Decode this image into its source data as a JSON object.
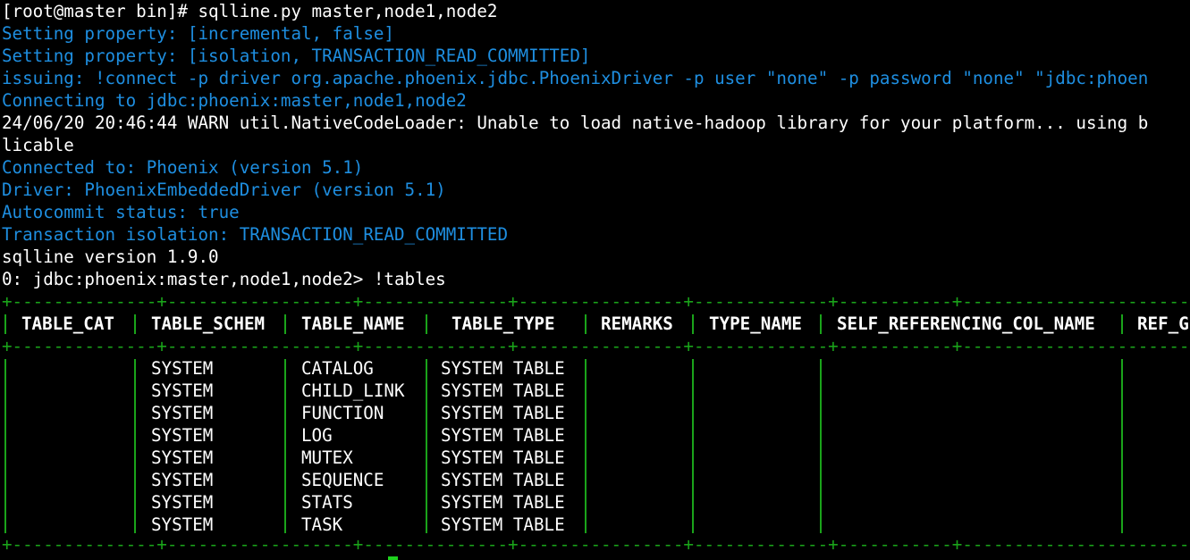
{
  "terminal": {
    "lines": [
      {
        "text": "[root@master bin]# sqlline.py master,node1,node2",
        "color": "white"
      },
      {
        "text": "Setting property: [incremental, false]",
        "color": "blue"
      },
      {
        "text": "Setting property: [isolation, TRANSACTION_READ_COMMITTED]",
        "color": "blue"
      },
      {
        "text": "issuing: !connect -p driver org.apache.phoenix.jdbc.PhoenixDriver -p user \"none\" -p password \"none\" \"jdbc:phoen",
        "color": "blue"
      },
      {
        "text": "Connecting to jdbc:phoenix:master,node1,node2",
        "color": "blue"
      },
      {
        "text": "24/06/20 20:46:44 WARN util.NativeCodeLoader: Unable to load native-hadoop library for your platform... using b",
        "color": "white"
      },
      {
        "text": "licable",
        "color": "white"
      },
      {
        "text": "Connected to: Phoenix (version 5.1)",
        "color": "blue"
      },
      {
        "text": "Driver: PhoenixEmbeddedDriver (version 5.1)",
        "color": "blue"
      },
      {
        "text": "Autocommit status: true",
        "color": "blue"
      },
      {
        "text": "Transaction isolation: TRANSACTION_READ_COMMITTED",
        "color": "blue"
      },
      {
        "text": "sqlline version 1.9.0",
        "color": "white"
      },
      {
        "text": "0: jdbc:phoenix:master,node1,node2> !tables",
        "color": "white"
      }
    ]
  },
  "table": {
    "border_text": "+--------------+------------------+--------------+----------------+-------------+-----------+--------------------------+----------",
    "columns": [
      "TABLE_CAT",
      "TABLE_SCHEM",
      "TABLE_NAME",
      "TABLE_TYPE",
      "REMARKS",
      "TYPE_NAME",
      "SELF_REFERENCING_COL_NAME",
      "REF_G"
    ],
    "rows": [
      {
        "schem": "SYSTEM",
        "name": "CATALOG",
        "type": "SYSTEM TABLE"
      },
      {
        "schem": "SYSTEM",
        "name": "CHILD_LINK",
        "type": "SYSTEM TABLE"
      },
      {
        "schem": "SYSTEM",
        "name": "FUNCTION",
        "type": "SYSTEM TABLE"
      },
      {
        "schem": "SYSTEM",
        "name": "LOG",
        "type": "SYSTEM TABLE"
      },
      {
        "schem": "SYSTEM",
        "name": "MUTEX",
        "type": "SYSTEM TABLE"
      },
      {
        "schem": "SYSTEM",
        "name": "SEQUENCE",
        "type": "SYSTEM TABLE"
      },
      {
        "schem": "SYSTEM",
        "name": "STATS",
        "type": "SYSTEM TABLE"
      },
      {
        "schem": "SYSTEM",
        "name": "TASK",
        "type": "SYSTEM TABLE"
      }
    ]
  },
  "colors": {
    "background": "#000000",
    "text": "#ffffff",
    "info": "#1e8ee0",
    "table_border": "#1aa31a",
    "cursor": "#1dd11d"
  }
}
